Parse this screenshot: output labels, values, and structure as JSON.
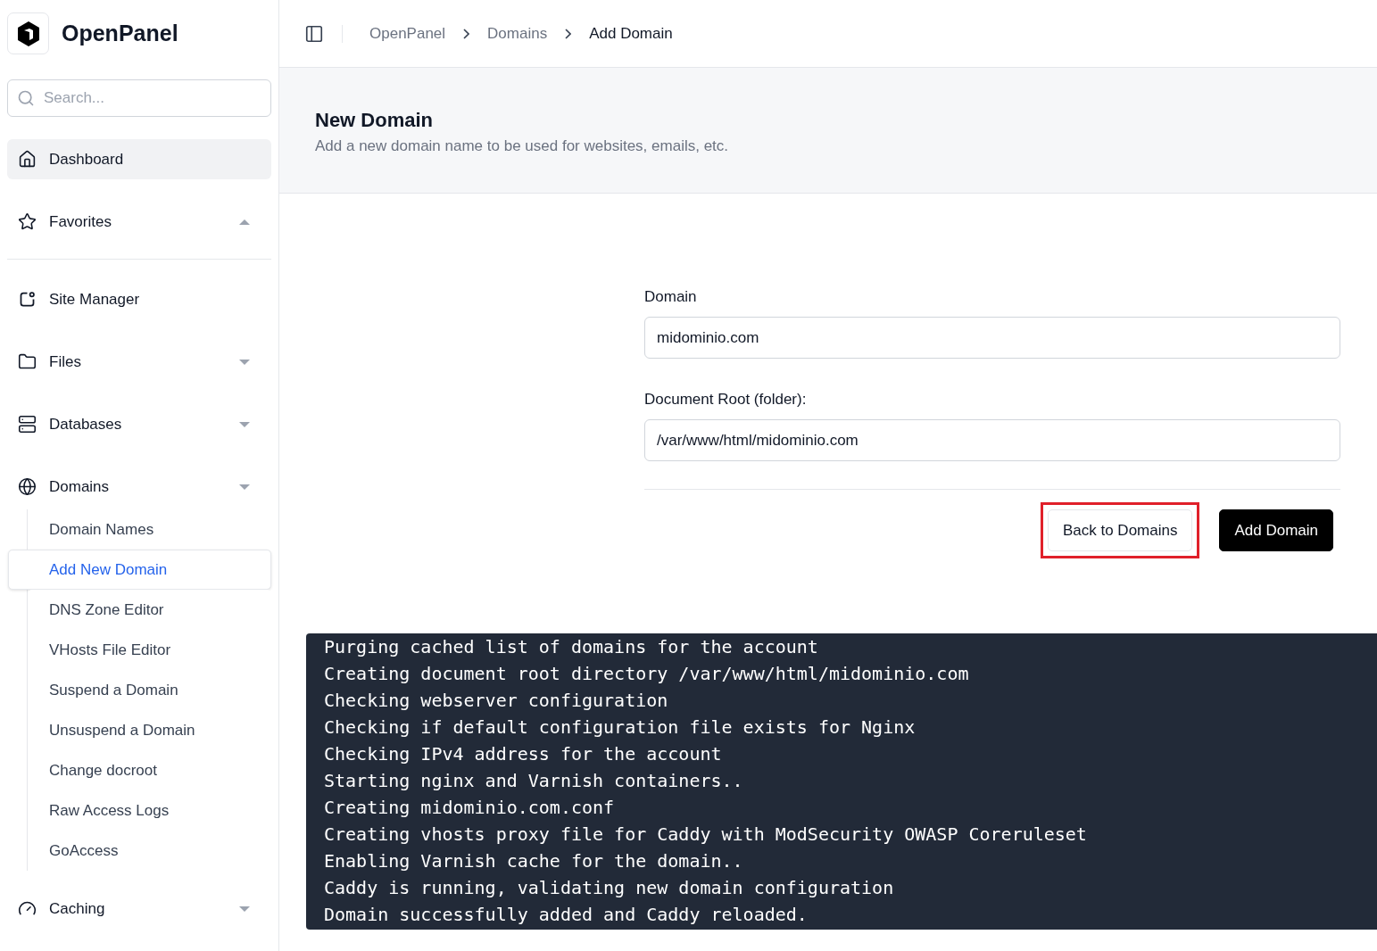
{
  "brand": {
    "name": "OpenPanel"
  },
  "search": {
    "placeholder": "Search..."
  },
  "nav": [
    {
      "kind": "link",
      "label": "Dashboard",
      "hovered": true,
      "selected": false
    },
    {
      "kind": "group",
      "label": "Favorites",
      "expanded": true,
      "selected": false
    },
    {
      "kind": "link",
      "label": "Site Manager",
      "hovered": false,
      "selected": false
    },
    {
      "kind": "group",
      "label": "Files",
      "expanded": false,
      "selected": false
    },
    {
      "kind": "group",
      "label": "Databases",
      "expanded": false,
      "selected": false
    },
    {
      "kind": "group",
      "label": "Domains",
      "expanded": false,
      "selected": false,
      "children": [
        {
          "label": "Domain Names",
          "selected": false
        },
        {
          "label": "Add New Domain",
          "selected": true
        },
        {
          "label": "DNS Zone Editor",
          "selected": false
        },
        {
          "label": "VHosts File Editor",
          "selected": false
        },
        {
          "label": "Suspend a Domain",
          "selected": false
        },
        {
          "label": "Unsuspend a Domain",
          "selected": false
        },
        {
          "label": "Change docroot",
          "selected": false
        },
        {
          "label": "Raw Access Logs",
          "selected": false
        },
        {
          "label": "GoAccess",
          "selected": false
        }
      ]
    },
    {
      "kind": "group",
      "label": "Caching",
      "expanded": false,
      "selected": false
    }
  ],
  "breadcrumbs": [
    {
      "label": "OpenPanel",
      "current": false
    },
    {
      "label": "Domains",
      "current": false
    },
    {
      "label": "Add Domain",
      "current": true
    }
  ],
  "page": {
    "title": "New Domain",
    "subtitle": "Add a new domain name to be used for websites, emails, etc."
  },
  "form": {
    "fields": [
      {
        "label": "Domain",
        "value": "midominio.com"
      },
      {
        "label": "Document Root (folder):",
        "value": "/var/www/html/midominio.com"
      }
    ],
    "buttons": [
      {
        "kind": "secondary",
        "label": "Back to Domains",
        "highlighted": true
      },
      {
        "kind": "primary",
        "label": "Add Domain",
        "highlighted": false
      }
    ]
  },
  "log": [
    "Purging cached list of domains for the account",
    "Creating document root directory /var/www/html/midominio.com",
    "Checking webserver configuration",
    "Checking if default configuration file exists for Nginx",
    "Checking IPv4 address for the account",
    "Starting nginx and Varnish containers..",
    "Creating midominio.com.conf",
    "Creating vhosts proxy file for Caddy with ModSecurity OWASP Coreruleset",
    "Enabling Varnish cache for the domain..",
    "Caddy is running, validating new domain configuration",
    "Domain successfully added and Caddy reloaded."
  ]
}
